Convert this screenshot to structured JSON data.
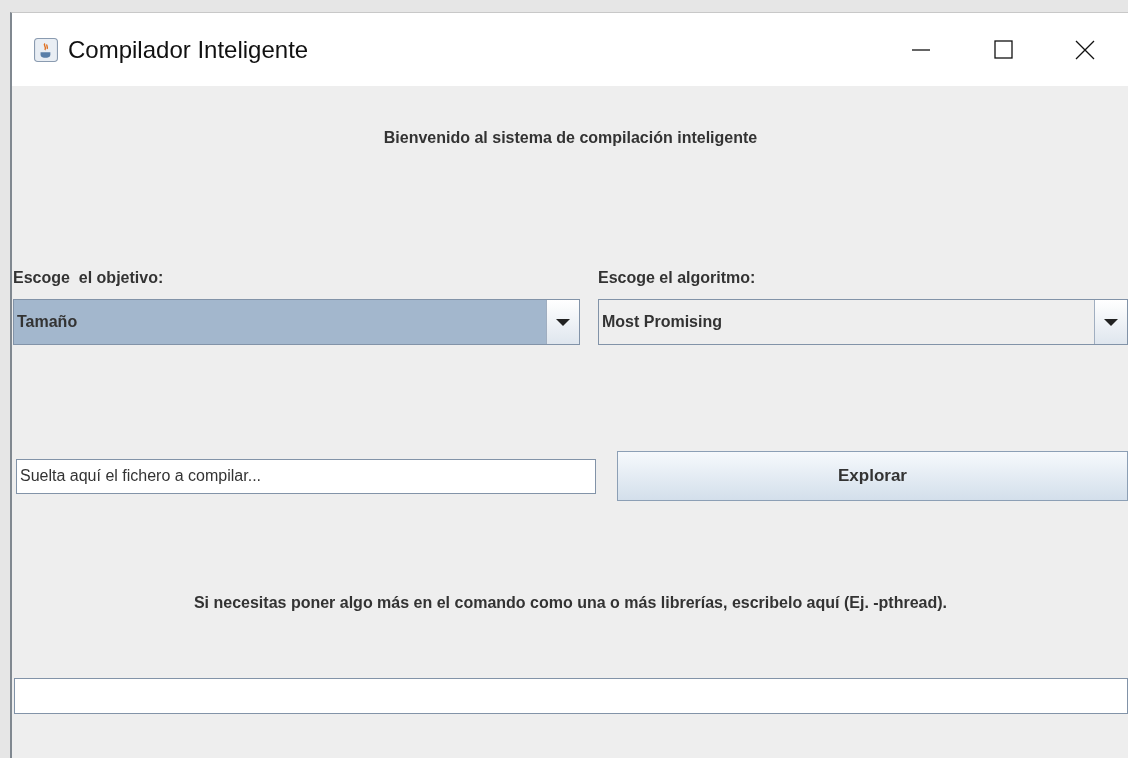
{
  "window": {
    "title": "Compilador Inteligente"
  },
  "welcome": "Bienvenido al sistema de compilación inteligente",
  "objective": {
    "label": "Escoge  el objetivo:",
    "value": "Tamaño",
    "focused": true
  },
  "algorithm": {
    "label": "Escoge el algoritmo:",
    "value": "Most Promising",
    "focused": false
  },
  "file_field": {
    "value": "Suelta aquí el fichero a compilar..."
  },
  "explore_button": "Explorar",
  "instructions": "Si necesitas poner algo más en el comando como una o más librerías, escribelo aquí (Ej. -pthread)."
}
